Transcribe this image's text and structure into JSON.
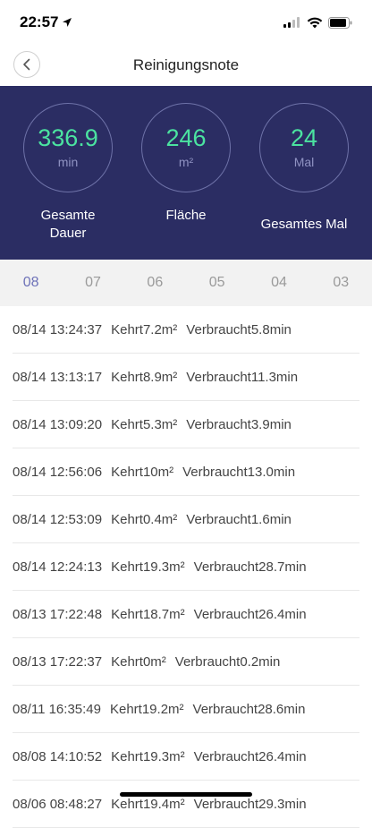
{
  "status": {
    "time": "22:57"
  },
  "nav": {
    "title": "Reinigungsnote"
  },
  "stats": [
    {
      "value": "336.9",
      "unit": "min",
      "label": "Gesamte Dauer"
    },
    {
      "value": "246",
      "unit": "m²",
      "label": "Fläche"
    },
    {
      "value": "24",
      "unit": "Mal",
      "label": "Gesamtes Mal"
    }
  ],
  "tabs": [
    "08",
    "07",
    "06",
    "05",
    "04",
    "03"
  ],
  "records": [
    {
      "datetime": "08/14 13:24:37",
      "area": "Kehrt7.2m²",
      "used": "Verbraucht5.8min"
    },
    {
      "datetime": "08/14 13:13:17",
      "area": "Kehrt8.9m²",
      "used": "Verbraucht11.3min"
    },
    {
      "datetime": "08/14 13:09:20",
      "area": "Kehrt5.3m²",
      "used": "Verbraucht3.9min"
    },
    {
      "datetime": "08/14 12:56:06",
      "area": "Kehrt10m²",
      "used": "Verbraucht13.0min"
    },
    {
      "datetime": "08/14 12:53:09",
      "area": "Kehrt0.4m²",
      "used": "Verbraucht1.6min"
    },
    {
      "datetime": "08/14 12:24:13",
      "area": "Kehrt19.3m²",
      "used": "Verbraucht28.7min"
    },
    {
      "datetime": "08/13 17:22:48",
      "area": "Kehrt18.7m²",
      "used": "Verbraucht26.4min"
    },
    {
      "datetime": "08/13 17:22:37",
      "area": "Kehrt0m²",
      "used": "Verbraucht0.2min"
    },
    {
      "datetime": "08/11 16:35:49",
      "area": "Kehrt19.2m²",
      "used": "Verbraucht28.6min"
    },
    {
      "datetime": "08/08 14:10:52",
      "area": "Kehrt19.3m²",
      "used": "Verbraucht26.4min"
    },
    {
      "datetime": "08/06 08:48:27",
      "area": "Kehrt19.4m²",
      "used": "Verbraucht29.3min"
    }
  ]
}
